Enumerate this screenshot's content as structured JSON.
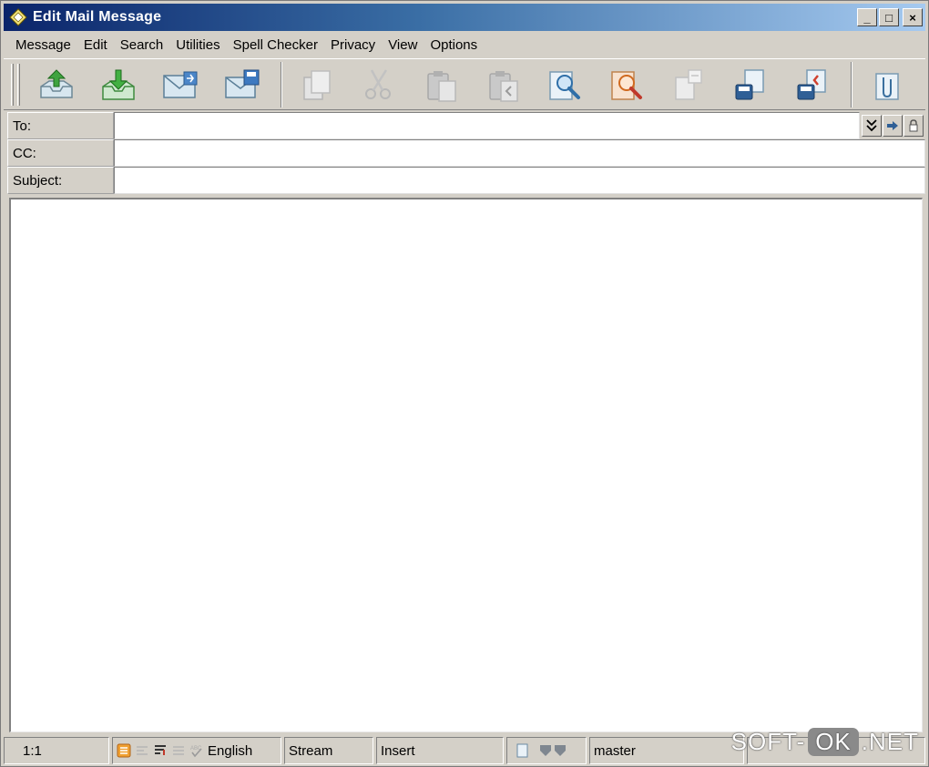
{
  "window": {
    "title": "Edit Mail Message",
    "controls": {
      "minimize": "_",
      "maximize": "□",
      "close": "×"
    }
  },
  "menu": [
    "Message",
    "Edit",
    "Search",
    "Utilities",
    "Spell Checker",
    "Privacy",
    "View",
    "Options"
  ],
  "toolbar": {
    "buttons": [
      {
        "name": "send-now",
        "icon": "outbox-upload-icon"
      },
      {
        "name": "queue-message",
        "icon": "inbox-download-icon"
      },
      {
        "name": "send-later",
        "icon": "mail-clock-icon"
      },
      {
        "name": "save-draft",
        "icon": "mail-save-icon"
      },
      {
        "name": "copy",
        "icon": "copy-icon"
      },
      {
        "name": "cut",
        "icon": "scissors-icon"
      },
      {
        "name": "paste",
        "icon": "paste-icon"
      },
      {
        "name": "paste-quoted",
        "icon": "paste-quote-icon"
      },
      {
        "name": "find",
        "icon": "find-icon"
      },
      {
        "name": "find-replace",
        "icon": "find-replace-icon"
      },
      {
        "name": "insert-file",
        "icon": "insert-file-icon"
      },
      {
        "name": "save-to-disk",
        "icon": "save-disk-icon"
      },
      {
        "name": "attach-from-disk",
        "icon": "attach-disk-icon"
      },
      {
        "name": "attachment",
        "icon": "paperclip-doc-icon"
      }
    ]
  },
  "fields": {
    "to": {
      "label": "To:",
      "value": ""
    },
    "cc": {
      "label": "CC:",
      "value": ""
    },
    "subject": {
      "label": "Subject:",
      "value": ""
    }
  },
  "body": {
    "text": ""
  },
  "status": {
    "position": "1:1",
    "language": "English",
    "encoding": "Stream",
    "mode": "Insert",
    "account": "master"
  },
  "watermark": {
    "left": "SOFT-",
    "box": "OK",
    "right": ".NET"
  },
  "colors": {
    "titlebar_start": "#0a246a",
    "titlebar_end": "#a6caf0",
    "face": "#d4d0c8"
  }
}
